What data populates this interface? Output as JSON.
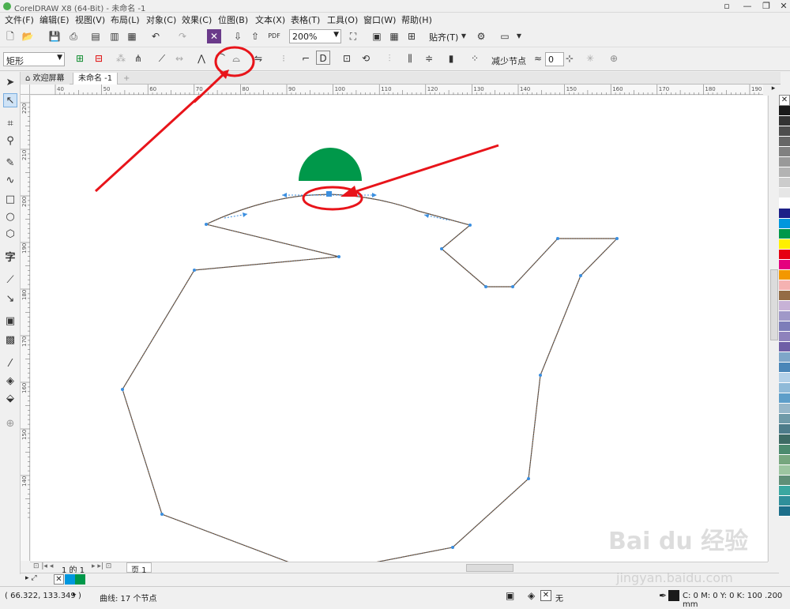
{
  "window": {
    "title": "CorelDRAW X8 (64-Bit) - 未命名 -1"
  },
  "menu": [
    "文件(F)",
    "编辑(E)",
    "视图(V)",
    "布局(L)",
    "对象(C)",
    "效果(C)",
    "位图(B)",
    "文本(X)",
    "表格(T)",
    "工具(O)",
    "窗口(W)",
    "帮助(H)"
  ],
  "toolbar": {
    "zoom_value": "200%",
    "snap_label": "贴齐(T)"
  },
  "property_bar": {
    "object_type": "矩形",
    "reduce_nodes_label": "减少节点",
    "smoothness_value": "0"
  },
  "tabs": {
    "welcome": "欢迎屏幕",
    "document": "未命名 -1"
  },
  "hruler_ticks": [
    "40",
    "50",
    "60",
    "70",
    "80",
    "90",
    "100",
    "110",
    "120",
    "130",
    "140",
    "150",
    "160",
    "170",
    "180",
    "190"
  ],
  "vruler_ticks": [
    "220",
    "210",
    "200",
    "190",
    "180",
    "170",
    "160",
    "150",
    "140"
  ],
  "page_nav": {
    "page_info": "1 的 1",
    "page_tab": "页 1"
  },
  "status": {
    "coords": "( 66.322, 133.349 )",
    "selection_info": "曲线: 17 个节点",
    "fill_text": "无",
    "outline_text": "C: 0 M: 0 Y: 0 K: 100  .200 mm"
  },
  "colors": {
    "green_shape": "#00984a",
    "curve": "#6b4a2e",
    "annotation": "#e8141a",
    "handle": "#3b8fe0"
  },
  "palette": [
    "#1a1a1a",
    "#333333",
    "#4d4d4d",
    "#666666",
    "#808080",
    "#999999",
    "#b3b3b3",
    "#cccccc",
    "#e6e6e6",
    "#ffffff",
    "#1d2088",
    "#0097de",
    "#00984a",
    "#fff000",
    "#e60012",
    "#e4007f",
    "#f39800",
    "#f5b2b2",
    "#946c45",
    "#c7b2d6",
    "#a098c8",
    "#7d7db9",
    "#8e82bc",
    "#6f5ea6",
    "#7ea6c9",
    "#4a86b8",
    "#b4d1e8",
    "#8fbad8",
    "#5d9ec9",
    "#97b7c9",
    "#6f9aa8",
    "#4d7c8a",
    "#3d6b64",
    "#4b8a6e",
    "#76a67e",
    "#9cc5a0",
    "#5f8f77",
    "#3aa7a0",
    "#2f8f9a",
    "#1d6f8a"
  ],
  "doc_palette": [
    "#0097de",
    "#00984a"
  ],
  "watermark": {
    "brand": "Bai du 经验",
    "url": "jingyan.baidu.com"
  }
}
